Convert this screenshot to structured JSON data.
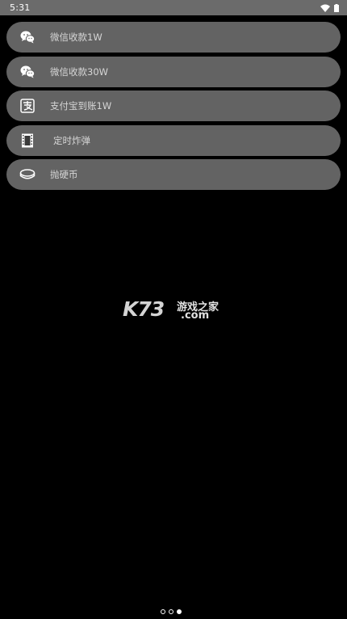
{
  "status_bar": {
    "time": "5:31"
  },
  "menu": {
    "items": [
      {
        "label": "微信收款1W",
        "icon": "wechat-icon"
      },
      {
        "label": "微信收款30W",
        "icon": "wechat-icon"
      },
      {
        "label": "支付宝到账1W",
        "icon": "alipay-icon"
      },
      {
        "label": "定时炸弹",
        "icon": "film-strip-icon"
      },
      {
        "label": "抛硬币",
        "icon": "coin-icon"
      }
    ]
  },
  "watermark": {
    "brand": "K73",
    "chinese": "游戏之家",
    "domain": ".com"
  },
  "pager": {
    "count": 3,
    "active_index": 2
  }
}
